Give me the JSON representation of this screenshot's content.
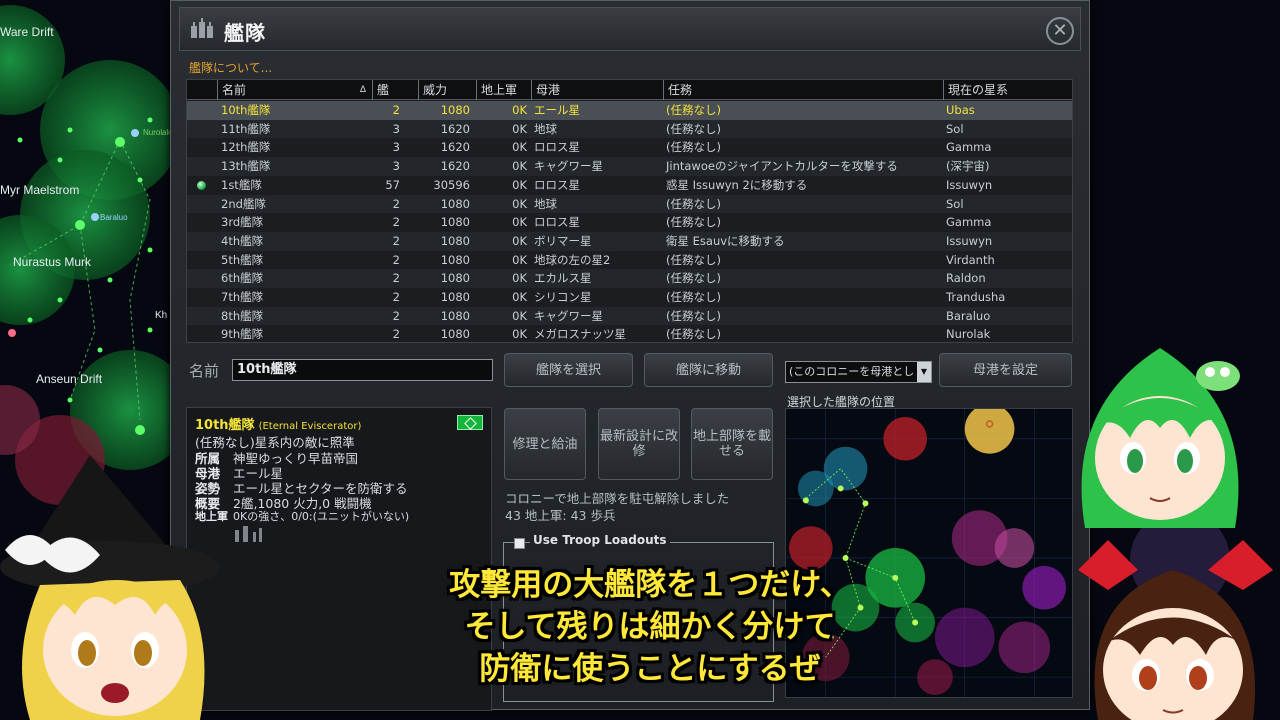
{
  "map": {
    "labels": [
      "Ware Drift",
      "Myr Maelstrom",
      "Nurastus Murk",
      "Anseun Drift",
      "Nurolak",
      "Baraluo",
      "Kh"
    ]
  },
  "window": {
    "title": "艦隊",
    "close_icon": "close-icon",
    "about_link": "艦隊について..."
  },
  "table": {
    "headers": [
      "名前",
      "艦",
      "威力",
      "地上軍",
      "母港",
      "任務",
      "現在の星系"
    ],
    "sort_indicator": "Δ",
    "rows": [
      {
        "name": "10th艦隊",
        "ships": "2",
        "power": "1080",
        "ground": "0K",
        "home": "エール星",
        "mission": "(任務なし)",
        "system": "Ubas",
        "marker": false
      },
      {
        "name": "11th艦隊",
        "ships": "3",
        "power": "1620",
        "ground": "0K",
        "home": "地球",
        "mission": "(任務なし)",
        "system": "Sol",
        "marker": false
      },
      {
        "name": "12th艦隊",
        "ships": "3",
        "power": "1620",
        "ground": "0K",
        "home": "ロロス星",
        "mission": "(任務なし)",
        "system": "Gamma",
        "marker": false
      },
      {
        "name": "13th艦隊",
        "ships": "3",
        "power": "1620",
        "ground": "0K",
        "home": "キャグワー星",
        "mission": "Jintawoeのジャイアントカルターを攻撃する",
        "system": "(深宇宙)",
        "marker": false
      },
      {
        "name": "1st艦隊",
        "ships": "57",
        "power": "30596",
        "ground": "0K",
        "home": "ロロス星",
        "mission": "惑星 Issuwyn 2に移動する",
        "system": "Issuwyn",
        "marker": true
      },
      {
        "name": "2nd艦隊",
        "ships": "2",
        "power": "1080",
        "ground": "0K",
        "home": "地球",
        "mission": "(任務なし)",
        "system": "Sol",
        "marker": false
      },
      {
        "name": "3rd艦隊",
        "ships": "2",
        "power": "1080",
        "ground": "0K",
        "home": "ロロス星",
        "mission": "(任務なし)",
        "system": "Gamma",
        "marker": false
      },
      {
        "name": "4th艦隊",
        "ships": "2",
        "power": "1080",
        "ground": "0K",
        "home": "ボリマー星",
        "mission": "衛星 Esauvに移動する",
        "system": "Issuwyn",
        "marker": false
      },
      {
        "name": "5th艦隊",
        "ships": "2",
        "power": "1080",
        "ground": "0K",
        "home": "地球の左の星2",
        "mission": "(任務なし)",
        "system": "Virdanth",
        "marker": false
      },
      {
        "name": "6th艦隊",
        "ships": "2",
        "power": "1080",
        "ground": "0K",
        "home": "エカルス星",
        "mission": "(任務なし)",
        "system": "Raldon",
        "marker": false
      },
      {
        "name": "7th艦隊",
        "ships": "2",
        "power": "1080",
        "ground": "0K",
        "home": "シリコン星",
        "mission": "(任務なし)",
        "system": "Trandusha",
        "marker": false
      },
      {
        "name": "8th艦隊",
        "ships": "2",
        "power": "1080",
        "ground": "0K",
        "home": "キャグワー星",
        "mission": "(任務なし)",
        "system": "Baraluo",
        "marker": false
      },
      {
        "name": "9th艦隊",
        "ships": "2",
        "power": "1080",
        "ground": "0K",
        "home": "メガロスナッツ星",
        "mission": "(任務なし)",
        "system": "Nurolak",
        "marker": false
      }
    ]
  },
  "controls": {
    "name_label": "名前",
    "name_value": "10th艦隊",
    "select_fleet": "艦隊を選択",
    "move_to_fleet": "艦隊に移動",
    "colony_dropdown": "(このコロニーを母港とし",
    "set_home": "母港を設定",
    "repair_refuel": "修理と給油",
    "upgrade": "最新設計に改修",
    "load_troops": "地上部隊を載せる",
    "minimap_title": "選択した艦隊の位置"
  },
  "info": {
    "fleet_name": "10th艦隊",
    "fleet_class": "(Eternal Eviscerator)",
    "status": "(任務なし)星系内の敵に照準",
    "owner_key": "所属",
    "owner_val": "神聖ゆっくり早苗帝国",
    "home_key": "母港",
    "home_val": "エール星",
    "stance_key": "姿勢",
    "stance_val": "エール星とセクターを防衛する",
    "summary_key": "概要",
    "summary_val": "2艦,1080 火力,0 戦闘機",
    "ground_key": "地上軍",
    "ground_val": "0Kの強さ、0/0:(ユニットがいない)"
  },
  "troops": {
    "message_line1": "コロニーで地上部隊を駐屯解除しました",
    "message_line2": "43 地上軍: 43 歩兵",
    "use_loadouts": "Use Troop Loadouts"
  },
  "subtitle": {
    "line1": "攻撃用の大艦隊を１つだけ、",
    "line2": "そして残りは細かく分けて",
    "line3": "防衛に使うことにするぜ"
  },
  "colors": {
    "selected_row_text": "#f2e23a",
    "accent_orange": "#e2a530",
    "subtitle_yellow": "#ffe838"
  }
}
